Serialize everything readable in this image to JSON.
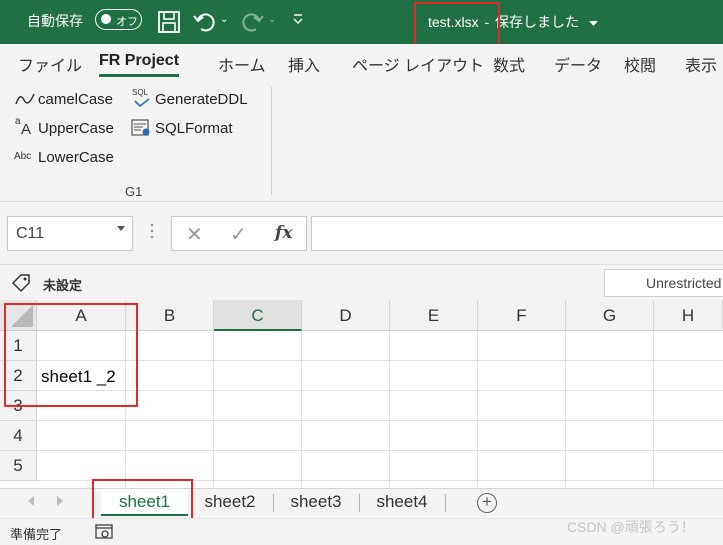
{
  "titlebar": {
    "autosave_label": "自動保存",
    "autosave_state": "オフ",
    "filename": "test.xlsx",
    "separator": "-",
    "save_status": "保存しました",
    "title_dropdown_icon": "chevron-down-icon",
    "undo_dropdown": "⌄",
    "redo_dropdown": "⌄"
  },
  "ribbon_tabs": [
    "ファイル",
    "FR Project",
    "ホーム",
    "挿入",
    "ページ レイアウト",
    "数式",
    "データ",
    "校閲",
    "表示"
  ],
  "ribbon_active_tab": "FR Project",
  "ribbon": {
    "items": [
      {
        "label": "camelCase",
        "icon": "camelcase-icon"
      },
      {
        "label": "GenerateDDL",
        "icon": "sql-icon"
      },
      {
        "label": "UpperCase",
        "icon": "uppercase-icon"
      },
      {
        "label": "SQLFormat",
        "icon": "sql-format-icon"
      },
      {
        "label": "LowerCase",
        "icon": "lowercase-icon"
      }
    ],
    "group_label": "G1",
    "icon_text": {
      "sql": "SQL",
      "upper_small": "a",
      "upper_big": "A",
      "lower": "Abc"
    }
  },
  "formula_bar": {
    "name_box": "C11",
    "cancel_icon": "✕",
    "enter_icon": "✓",
    "fx_label": "fx",
    "value": ""
  },
  "sensitivity": {
    "label": "未設定",
    "box_text": "Unrestricted"
  },
  "grid": {
    "columns": [
      "A",
      "B",
      "C",
      "D",
      "E",
      "F",
      "G",
      "H"
    ],
    "selected_column": "C",
    "rows": [
      "1",
      "2",
      "3",
      "4",
      "5"
    ],
    "cells": {
      "A2": "sheet1 _2"
    }
  },
  "sheets": {
    "tabs": [
      "sheet1",
      "sheet2",
      "sheet3",
      "sheet4"
    ],
    "active": "sheet1",
    "add_label": "+"
  },
  "status": {
    "ready_text": "準備完了"
  },
  "watermark": "CSDN @頑張ろう！",
  "colors": {
    "excel_green": "#1f7145",
    "highlight_red": "#e02a2a"
  }
}
